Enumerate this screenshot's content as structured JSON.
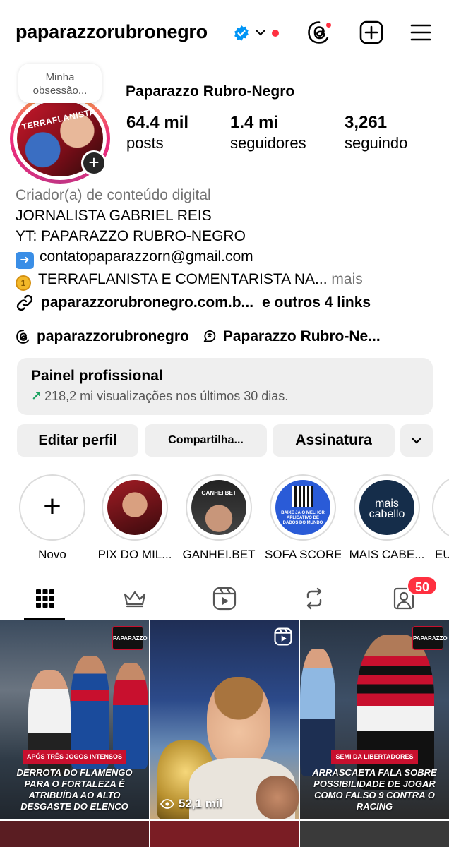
{
  "header": {
    "username": "paparazzorubronegro"
  },
  "profile": {
    "note": "Minha obsessão...",
    "display_name": "Paparazzo Rubro-Negro",
    "stats": [
      {
        "value": "64.4 mil",
        "label": "posts"
      },
      {
        "value": "1.4 mi",
        "label": "seguidores"
      },
      {
        "value": "3,261",
        "label": "seguindo"
      }
    ],
    "avatar_text": "TERRAFLANISTA"
  },
  "bio": {
    "category": "Criador(a) de conteúdo digital",
    "line1": "JORNALISTA GABRIEL REIS",
    "line2": "YT: PAPARAZZO RUBRO-NEGRO",
    "line3": "contatopaparazzorn@gmail.com",
    "line4": "TERRAFLANISTA E COMENTARISTA NA...",
    "more": " mais"
  },
  "links": {
    "main": "paparazzorubronegro.com.b...",
    "others": "e outros 4 links"
  },
  "threads": {
    "handle": "paparazzorubronegro",
    "channel": "Paparazzo Rubro-Ne..."
  },
  "panel": {
    "title": "Painel profissional",
    "subtitle": "218,2 mi visualizações nos últimos 30 dias."
  },
  "buttons": {
    "edit": "Editar perfil",
    "share": "Compartilha...",
    "subscription": "Assinatura"
  },
  "highlights": [
    {
      "label": "Novo"
    },
    {
      "label": "PIX DO MIL..."
    },
    {
      "label": "GANHEI.BET"
    },
    {
      "label": "SOFA SCORE"
    },
    {
      "label": "MAIS CABE..."
    },
    {
      "label": "EU..."
    }
  ],
  "highlight_img_text": {
    "ganhei": "GANHEI BET",
    "sofa": "BAIXE JÁ O MELHOR APLICATIVO DE DADOS DO MUNDO",
    "mais": "mais cabello"
  },
  "tabs": {
    "tagged_badge": "50"
  },
  "posts": [
    {
      "tag": "APÓS TRÊS JOGOS INTENSOS",
      "caption": "DERROTA DO FLAMENGO PARA O FORTALEZA É ATRIBUÍDA AO ALTO DESGASTE DO ELENCO",
      "logo": "PAPARAZZO"
    },
    {
      "views": "52,1 mil"
    },
    {
      "tag": "SEMI DA LIBERTADORES",
      "caption": "ARRASCAETA FALA SOBRE POSSIBILIDADE DE JOGAR COMO FALSO 9 CONTRA O RACING",
      "logo": "PAPARAZZO"
    }
  ],
  "colors": {
    "accent_red": "#ff3040",
    "verified_blue": "#0095f6",
    "panel_bg": "#efefef",
    "growth_green": "#1aa260"
  }
}
